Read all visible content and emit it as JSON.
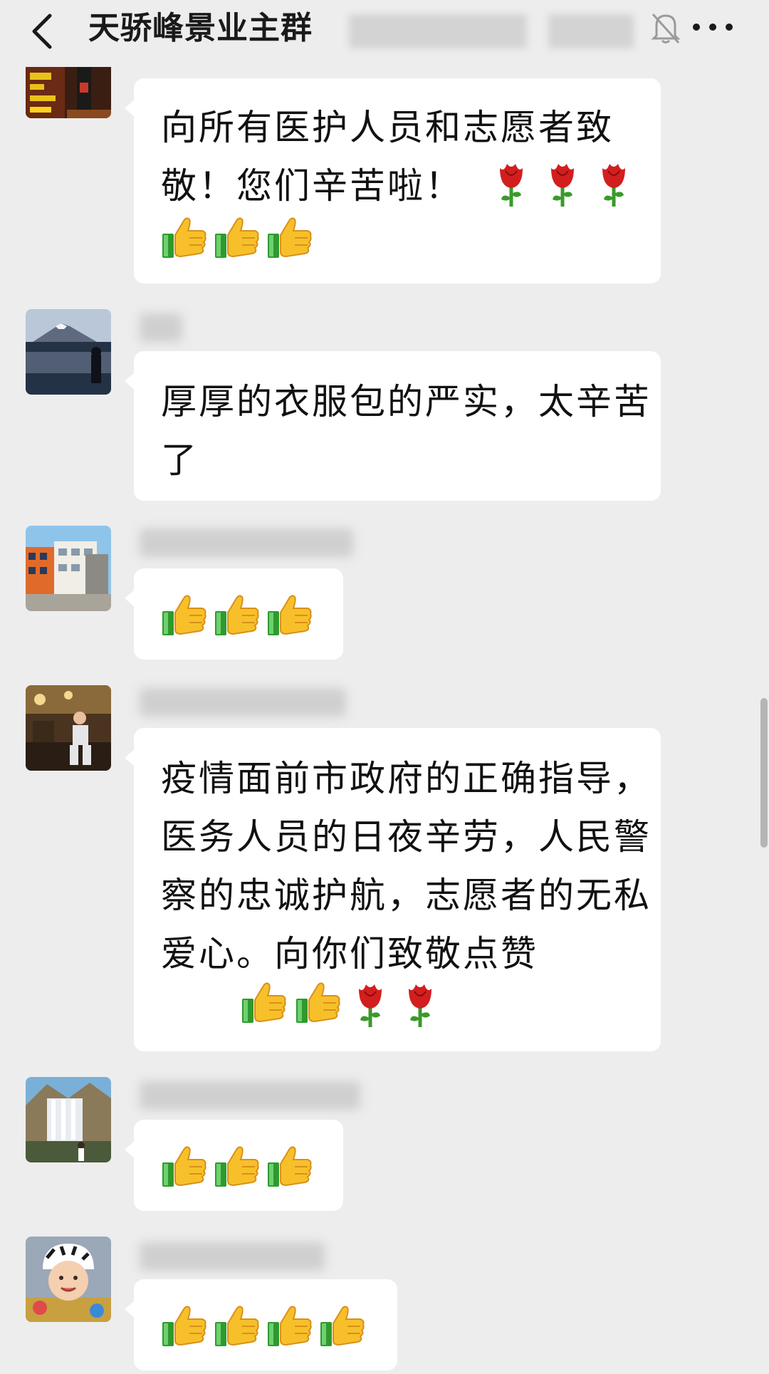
{
  "header": {
    "title": "天骄峰景业主群",
    "back_icon": "chevron-left-icon",
    "mute_icon": "bell-off-icon",
    "more_icon": "more-dots-icon"
  },
  "messages": [
    {
      "text": "向所有医护人员和志愿者致敬！您们辛苦啦！",
      "emoji": [
        "rose",
        "rose",
        "rose",
        "thumbs-up",
        "thumbs-up",
        "thumbs-up"
      ]
    },
    {
      "text": "厚厚的衣服包的严实，太辛苦了",
      "emoji": []
    },
    {
      "text": "",
      "emoji": [
        "thumbs-up",
        "thumbs-up",
        "thumbs-up"
      ]
    },
    {
      "text": "疫情面前市政府的正确指导，医务人员的日夜辛劳，人民警察的忠诚护航，志愿者的无私爱心。向你们致敬点赞",
      "emoji": [
        "thumbs-up",
        "thumbs-up",
        "rose",
        "rose"
      ]
    },
    {
      "text": "",
      "emoji": [
        "thumbs-up",
        "thumbs-up",
        "thumbs-up"
      ]
    },
    {
      "text": "",
      "emoji": [
        "thumbs-up",
        "thumbs-up",
        "thumbs-up",
        "thumbs-up"
      ]
    }
  ],
  "colors": {
    "background": "#ededed",
    "bubble": "#ffffff",
    "text": "#111111"
  }
}
